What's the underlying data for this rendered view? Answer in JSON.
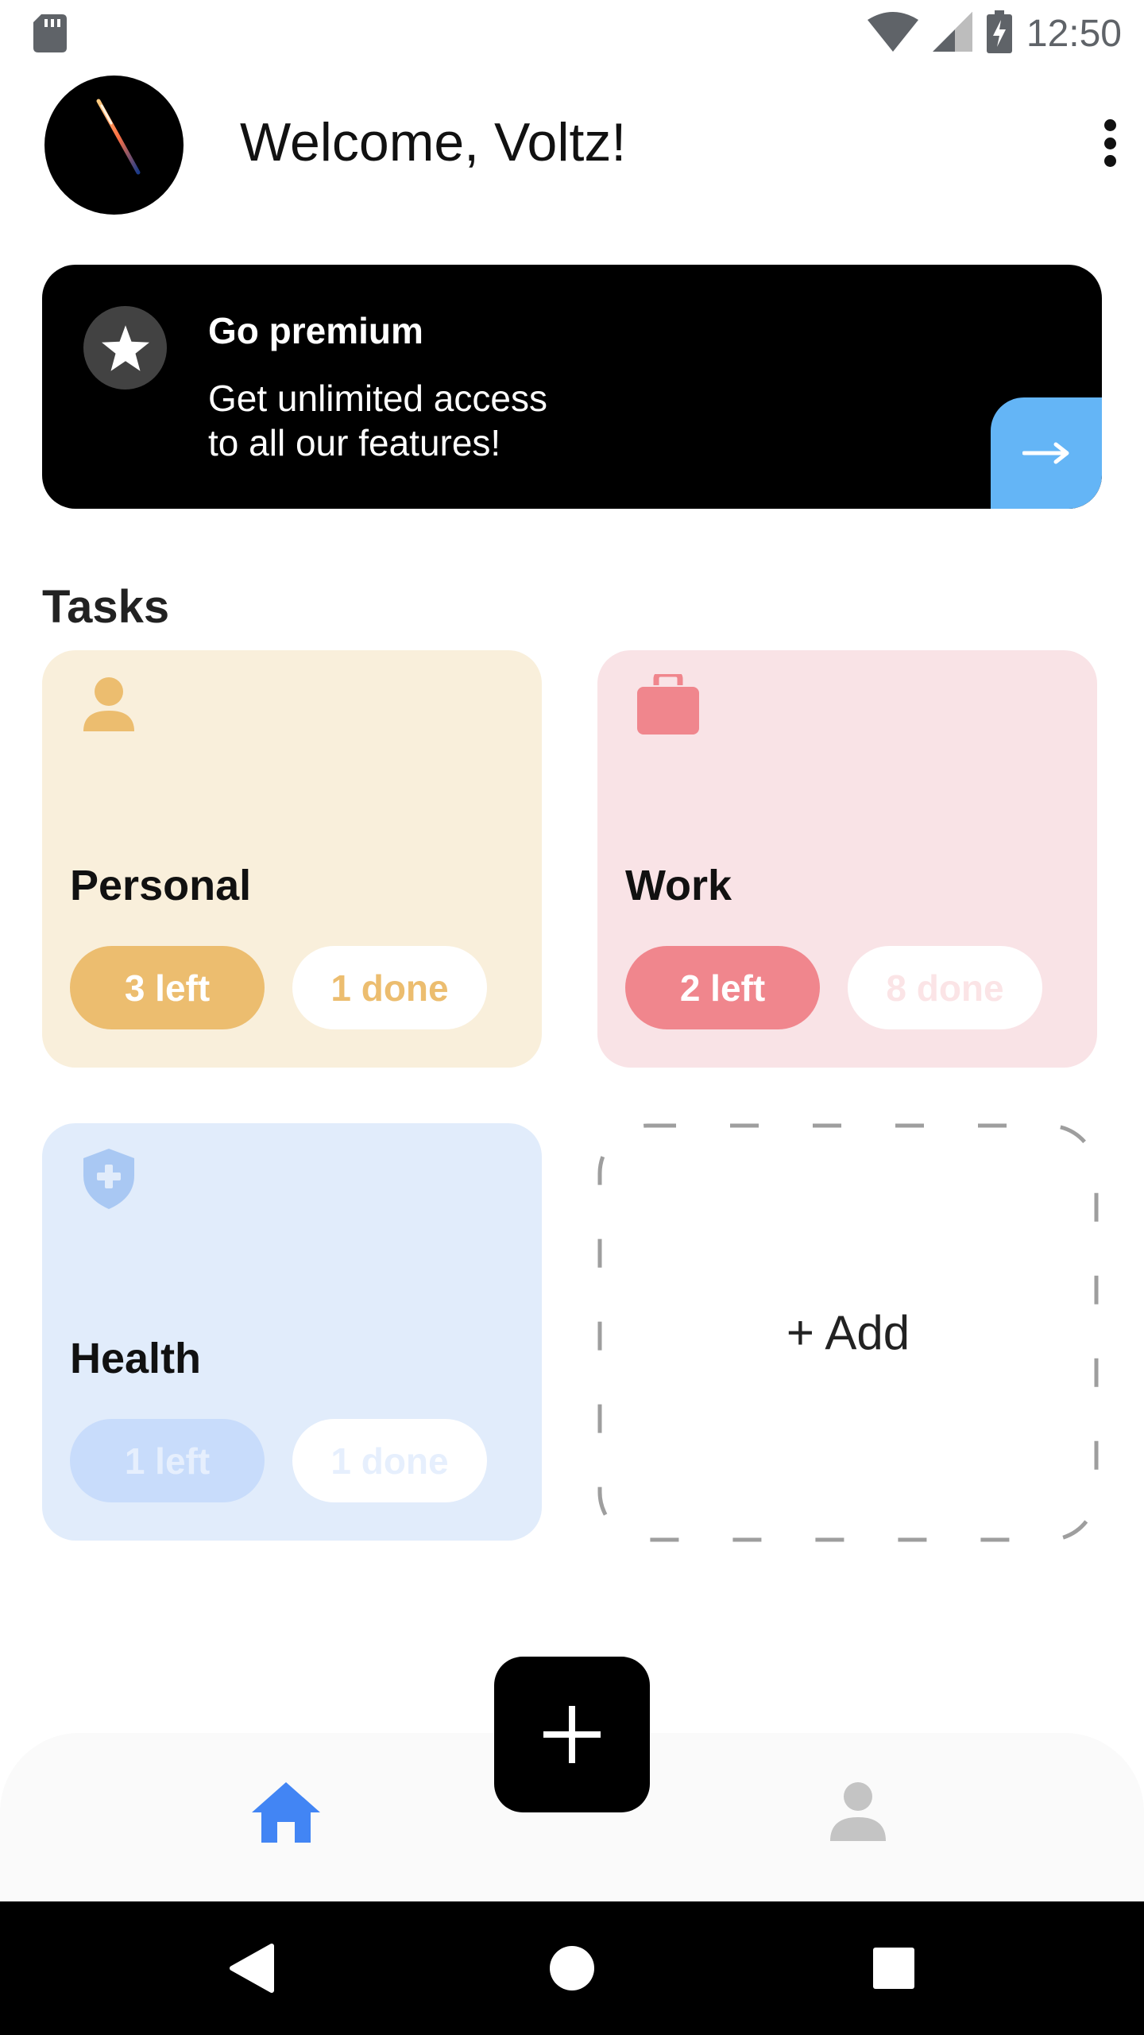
{
  "status_bar": {
    "time": "12:50",
    "icons": [
      "sd-card-icon",
      "wifi-icon",
      "signal-icon",
      "battery-charging-icon"
    ]
  },
  "header": {
    "welcome_text": "Welcome, Voltz!"
  },
  "premium": {
    "title": "Go premium",
    "line1": "Get unlimited access",
    "line2": "to all our features!",
    "arrow": "→"
  },
  "tasks": {
    "section_title": "Tasks",
    "categories": [
      {
        "name": "Personal",
        "left_label": "3 left",
        "done_label": "1 done",
        "color": "#ecbd6f",
        "icon": "person-icon"
      },
      {
        "name": "Work",
        "left_label": "2 left",
        "done_label": "8 done",
        "color": "#f0868d",
        "icon": "briefcase-icon"
      },
      {
        "name": "Health",
        "left_label": "1 left",
        "done_label": "1 done",
        "color": "#a9c8f3",
        "icon": "health-shield-icon"
      }
    ],
    "add_label": "+ Add"
  },
  "bottom_nav": {
    "active_color": "#4285f4",
    "inactive_color": "#c4c4c4"
  }
}
